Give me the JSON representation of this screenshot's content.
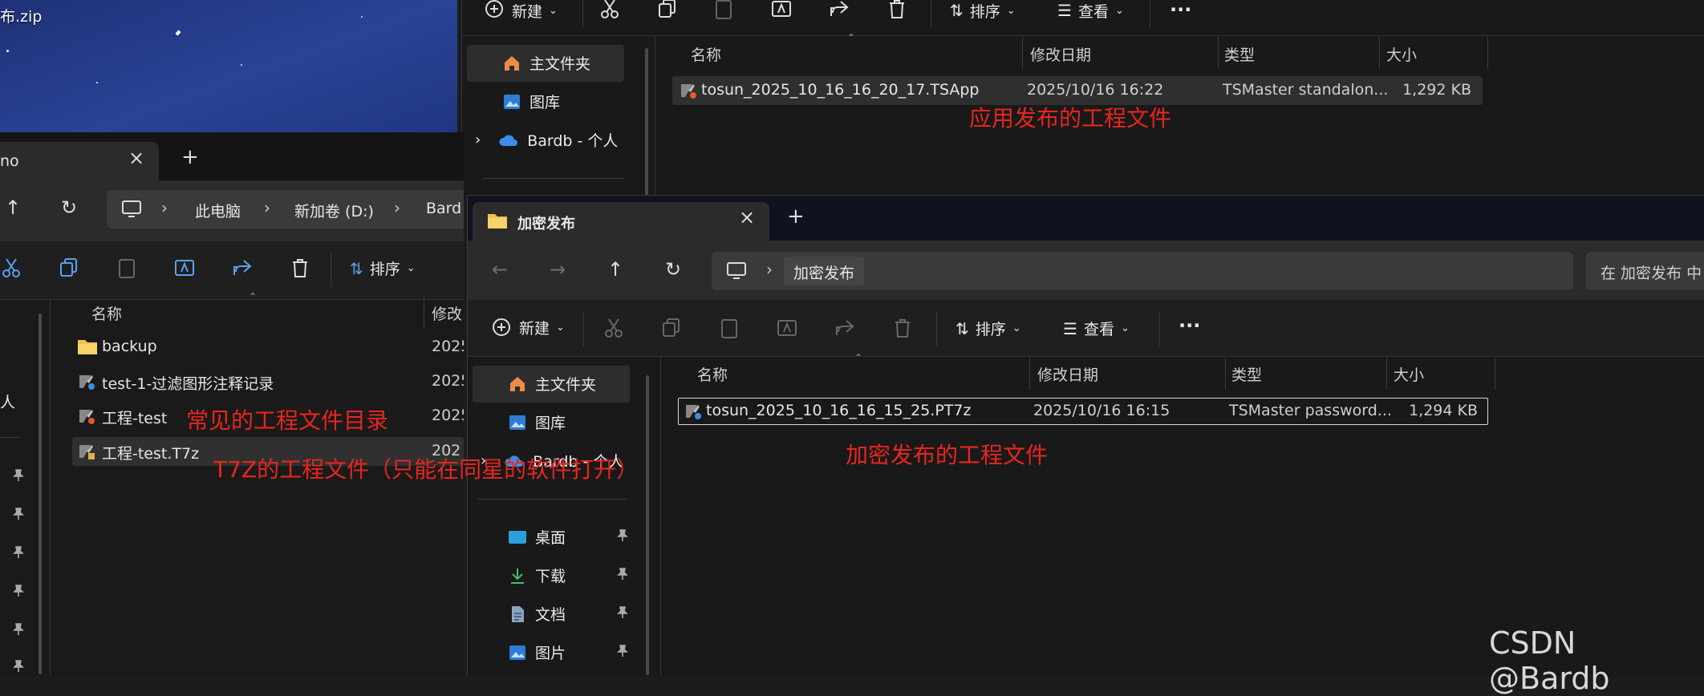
{
  "desktop": {
    "zip_label": "布.zip"
  },
  "back_window": {
    "toolbar": {
      "new_label": "新建",
      "sort_label": "排序",
      "view_label": "查看",
      "more_label": "···"
    },
    "nav": {
      "home_label": "主文件夹",
      "gallery_label": "图库",
      "cloud_label": "Bardb - 个人"
    },
    "columns": {
      "name": "名称",
      "date": "修改日期",
      "type": "类型",
      "size": "大小"
    },
    "file": {
      "name": "tosun_2025_10_16_16_20_17.TSApp",
      "date": "2025/10/16 16:22",
      "type": "TSMaster standalon...",
      "size": "1,292 KB"
    }
  },
  "left_window": {
    "tab_title": "no",
    "address": {
      "pc": "此电脑",
      "drive": "新加卷 (D:)",
      "folder": "Bard"
    },
    "toolbar": {
      "sort_label": "排序"
    },
    "columns": {
      "name": "名称",
      "date": "修改"
    },
    "nav_partial": "人",
    "files": [
      {
        "name": "backup",
        "date": "2025"
      },
      {
        "name": "test-1-过滤图形注释记录",
        "date": "2025"
      },
      {
        "name": "工程-test",
        "date": "2025"
      },
      {
        "name": "工程-test.T7z",
        "date": "202"
      }
    ]
  },
  "front_window": {
    "tab_title": "加密发布",
    "address": {
      "folder": "加密发布"
    },
    "search_placeholder": "在 加密发布 中",
    "toolbar": {
      "new_label": "新建",
      "sort_label": "排序",
      "view_label": "查看",
      "more_label": "···"
    },
    "nav": {
      "home_label": "主文件夹",
      "gallery_label": "图库",
      "cloud_label": "Bardb - 个人",
      "desktop_label": "桌面",
      "downloads_label": "下载",
      "documents_label": "文档",
      "pictures_label": "图片"
    },
    "columns": {
      "name": "名称",
      "date": "修改日期",
      "type": "类型",
      "size": "大小"
    },
    "file": {
      "name": "tosun_2025_10_16_16_15_25.PT7z",
      "date": "2025/10/16 16:15",
      "type": "TSMaster password...",
      "size": "1,294 KB"
    }
  },
  "annotations": {
    "app_release": "应用发布的工程文件",
    "common_dir": "常见的工程文件目录",
    "t7z_note": "T7Z的工程文件（只能在同星的软件打开）",
    "encrypted": "加密发布的工程文件"
  },
  "watermark": "CSDN @Bardb",
  "colors": {
    "annotation_red": "#e8251f",
    "folder_yellow": "#f2c14e",
    "cloud_blue": "#3b8eea",
    "desktop_bg": "#263a8a"
  }
}
